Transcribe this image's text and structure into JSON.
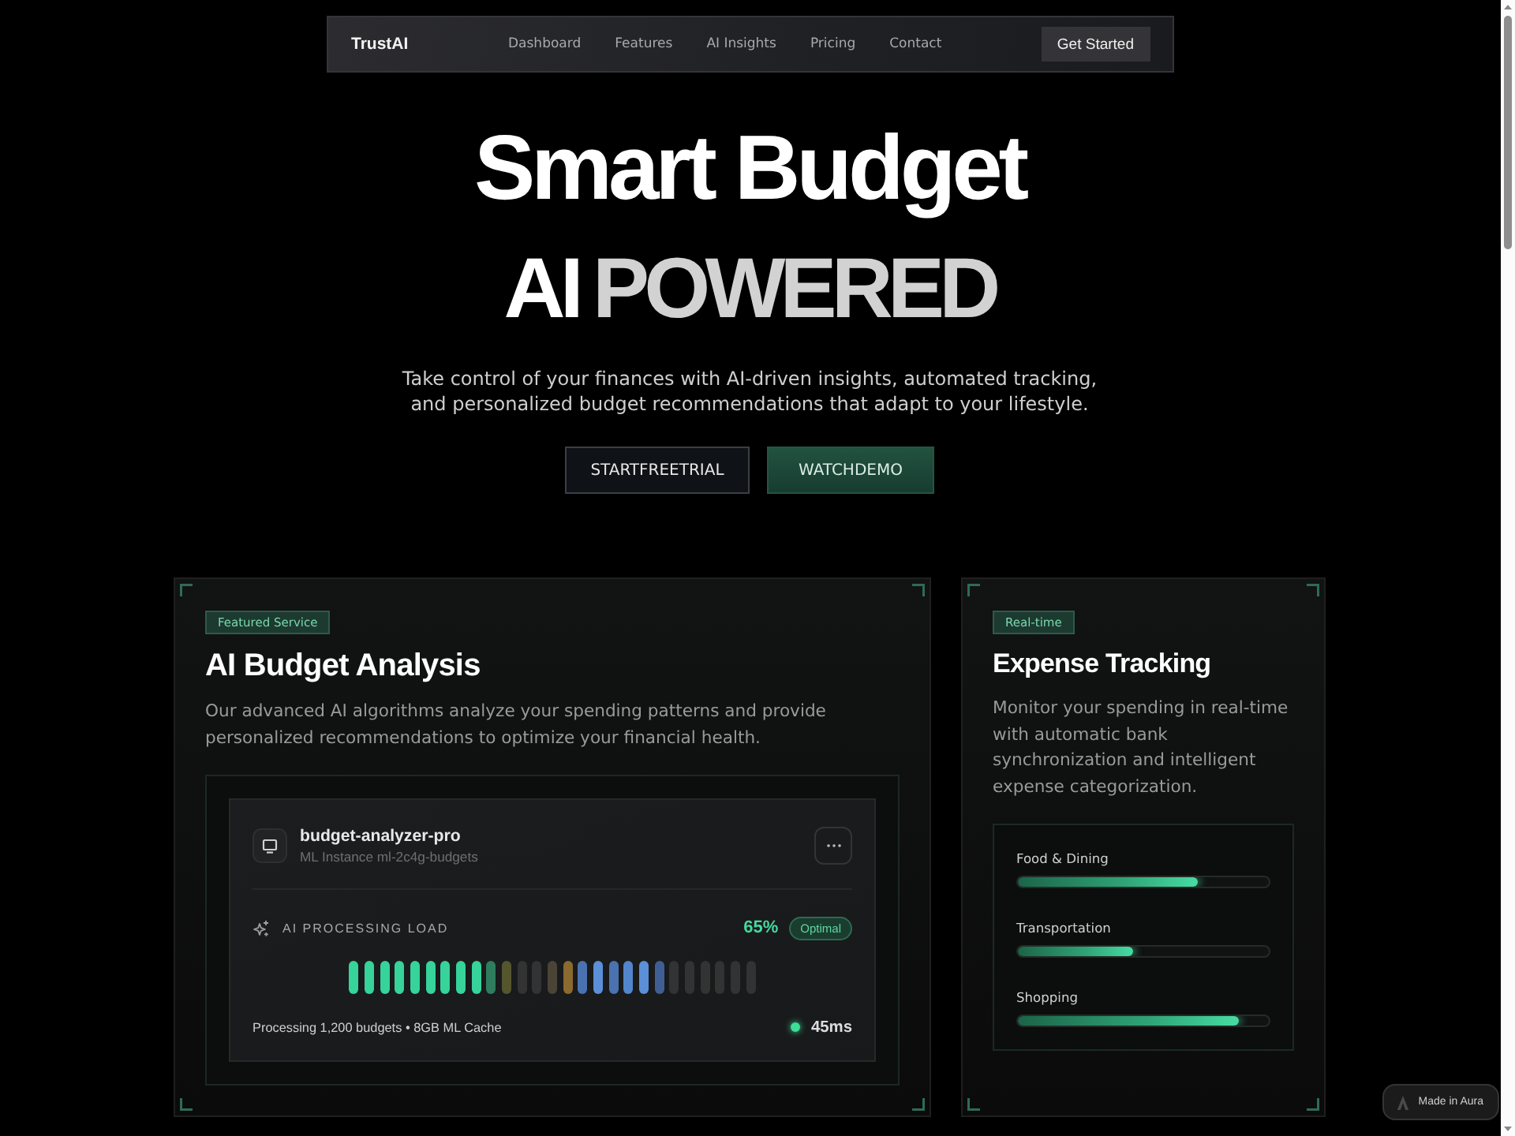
{
  "nav": {
    "brand": "TrustAI",
    "links": [
      "Dashboard",
      "Features",
      "AI Insights",
      "Pricing",
      "Contact"
    ],
    "cta": "Get Started"
  },
  "hero": {
    "title_line_1": "Smart Budget",
    "title_line_2_lead": "AI",
    "title_line_2_accent": "POWERED",
    "subtitle": "Take control of your finances with AI-driven insights, automated tracking, and personalized budget recommendations that adapt to your lifestyle.",
    "buttons": [
      {
        "label": "STARTFREETRIAL",
        "kind": "secondary"
      },
      {
        "label": "WATCHDEMO",
        "kind": "primary"
      }
    ]
  },
  "analysis_card": {
    "badge": "Featured Service",
    "title": "AI Budget Analysis",
    "description": "Our advanced AI algorithms analyze your spending patterns and provide personalized recommendations to optimize your financial health.",
    "instance": {
      "name": "budget-analyzer-pro",
      "subtitle": "ML Instance ml-2c4g-budgets"
    },
    "load": {
      "label": "AI PROCESSING LOAD",
      "percent": "65%",
      "status": "Optimal",
      "bars": [
        {
          "color": "#36d39a"
        },
        {
          "color": "#36d39a"
        },
        {
          "color": "#36d39a"
        },
        {
          "color": "#36d39a"
        },
        {
          "color": "#36d39a"
        },
        {
          "color": "#36d39a"
        },
        {
          "color": "#36d39a"
        },
        {
          "color": "#36d39a"
        },
        {
          "color": "#36d39a"
        },
        {
          "color": "#2e7d5e"
        },
        {
          "color": "#56562e"
        },
        {
          "color": "#333333"
        },
        {
          "color": "#333333"
        },
        {
          "color": "#4a4436"
        },
        {
          "color": "#8a6a2e"
        },
        {
          "color": "#4a72b0"
        },
        {
          "color": "#5b8fd8"
        },
        {
          "color": "#4a72b0"
        },
        {
          "color": "#5285cc"
        },
        {
          "color": "#5b8fd8"
        },
        {
          "color": "#3f5f94"
        },
        {
          "color": "#333333"
        },
        {
          "color": "#333333"
        },
        {
          "color": "#333333"
        },
        {
          "color": "#333333"
        },
        {
          "color": "#333333"
        },
        {
          "color": "#333333"
        }
      ],
      "footer": "Processing 1,200 budgets • 8GB ML Cache",
      "latency": "45ms"
    }
  },
  "expense_card": {
    "badge": "Real-time",
    "title": "Expense Tracking",
    "description": "Monitor your spending in real-time with automatic bank synchronization and intelligent expense categorization.",
    "categories": [
      {
        "name": "Food & Dining",
        "level": 0.72
      },
      {
        "name": "Transportation",
        "level": 0.46
      },
      {
        "name": "Shopping",
        "level": 0.88
      }
    ]
  },
  "made_with_badge": "Made in Aura"
}
